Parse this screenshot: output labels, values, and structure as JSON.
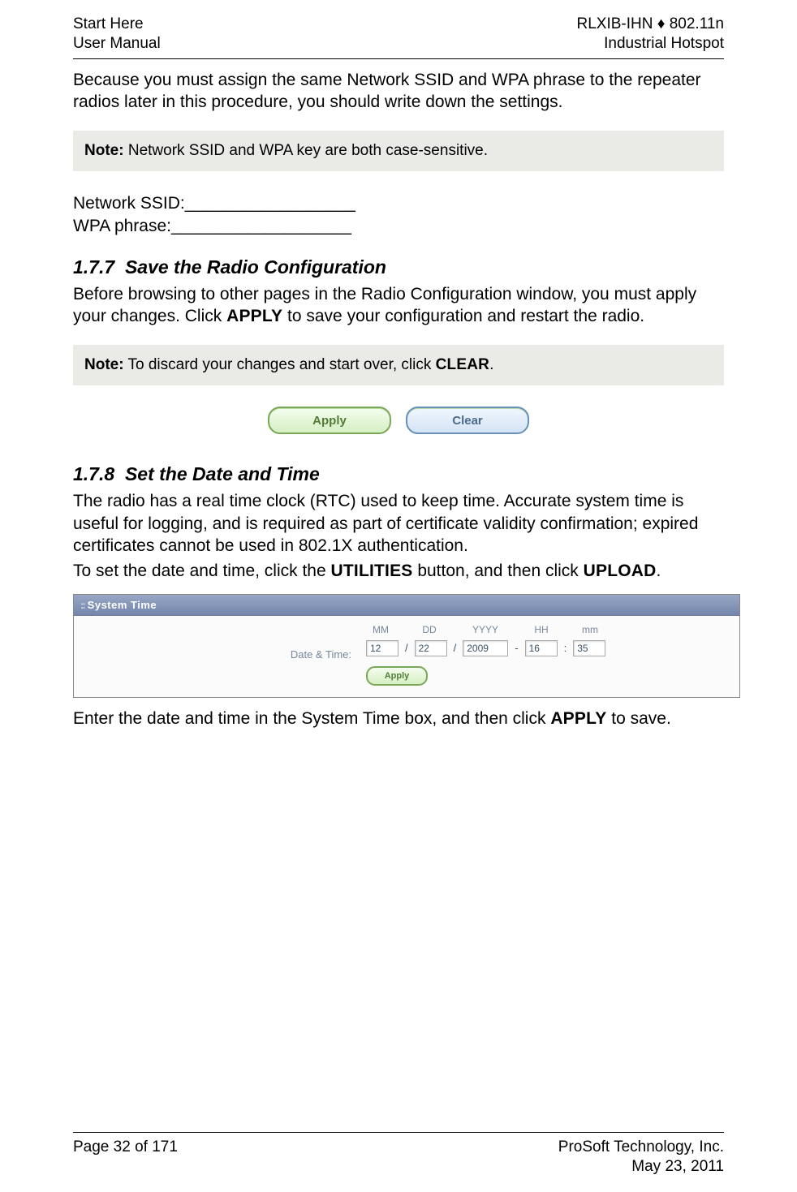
{
  "header": {
    "left_line1": "Start Here",
    "left_line2": "User Manual",
    "right_line1": "RLXIB-IHN ♦ 802.11n",
    "right_line2": "Industrial Hotspot"
  },
  "intro_paragraph": "Because you must assign the same Network SSID and WPA phrase to the repeater radios later in this procedure, you should write down the settings.",
  "note1": {
    "label": "Note:",
    "text": " Network SSID and WPA key are both case-sensitive."
  },
  "blanks": {
    "ssid": "Network SSID:__________________",
    "wpa": "WPA phrase:___________________"
  },
  "section_177": {
    "number": "1.7.7",
    "title": "Save the Radio Configuration",
    "para_pre": "Before browsing to other pages in the Radio Configuration window, you must apply your changes. Click ",
    "apply_word": "APPLY",
    "para_post": " to save your configuration and restart the radio."
  },
  "note2": {
    "label": "Note:",
    "text_pre": " To discard your changes and start over, click ",
    "clear_word": "CLEAR",
    "text_post": "."
  },
  "buttons": {
    "apply": "Apply",
    "clear": "Clear"
  },
  "section_178": {
    "number": "1.7.8",
    "title": "Set the Date and Time",
    "para1": "The radio has a real time clock (RTC) used to keep time. Accurate system time is useful for logging, and is required as part of certificate validity confirmation; expired certificates cannot be used in 802.1X authentication.",
    "para2_pre": "To set the date and time, click the ",
    "utilities_word": "UTILITIES",
    "para2_mid": " button, and then click ",
    "upload_word": "UPLOAD",
    "para2_post": "."
  },
  "system_time": {
    "panel_title": "System Time",
    "row_label": "Date & Time:",
    "headers": {
      "mm": "MM",
      "dd": "DD",
      "yyyy": "YYYY",
      "hh": "HH",
      "min": "mm"
    },
    "values": {
      "mm": "12",
      "dd": "22",
      "yyyy": "2009",
      "hh": "16",
      "min": "35"
    },
    "apply_label": "Apply"
  },
  "after_panel_pre": "Enter the date and time in the System Time box, and then click ",
  "after_panel_apply": "APPLY",
  "after_panel_post": " to save.",
  "footer": {
    "left": "Page 32 of 171",
    "right_line1": "ProSoft Technology, Inc.",
    "right_line2": "May 23, 2011"
  }
}
